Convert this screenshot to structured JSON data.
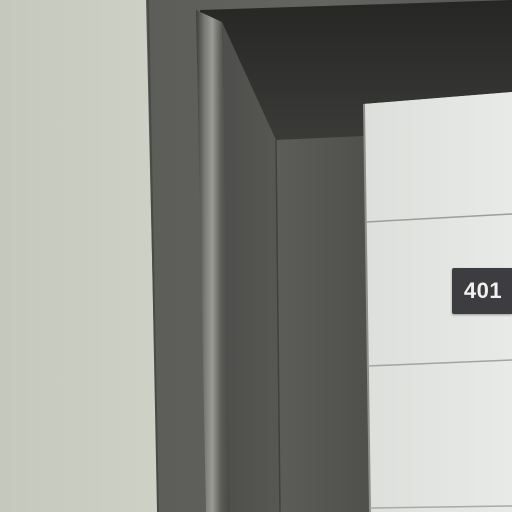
{
  "room_sign": {
    "number": "401"
  },
  "colors": {
    "wall": "#c9ccc0",
    "frame": "#5f605c",
    "frame_dark": "#2f302e",
    "door_panel": "#e4e6e3",
    "sign_background": "#3d3d41",
    "sign_text": "#f1f1ee"
  }
}
